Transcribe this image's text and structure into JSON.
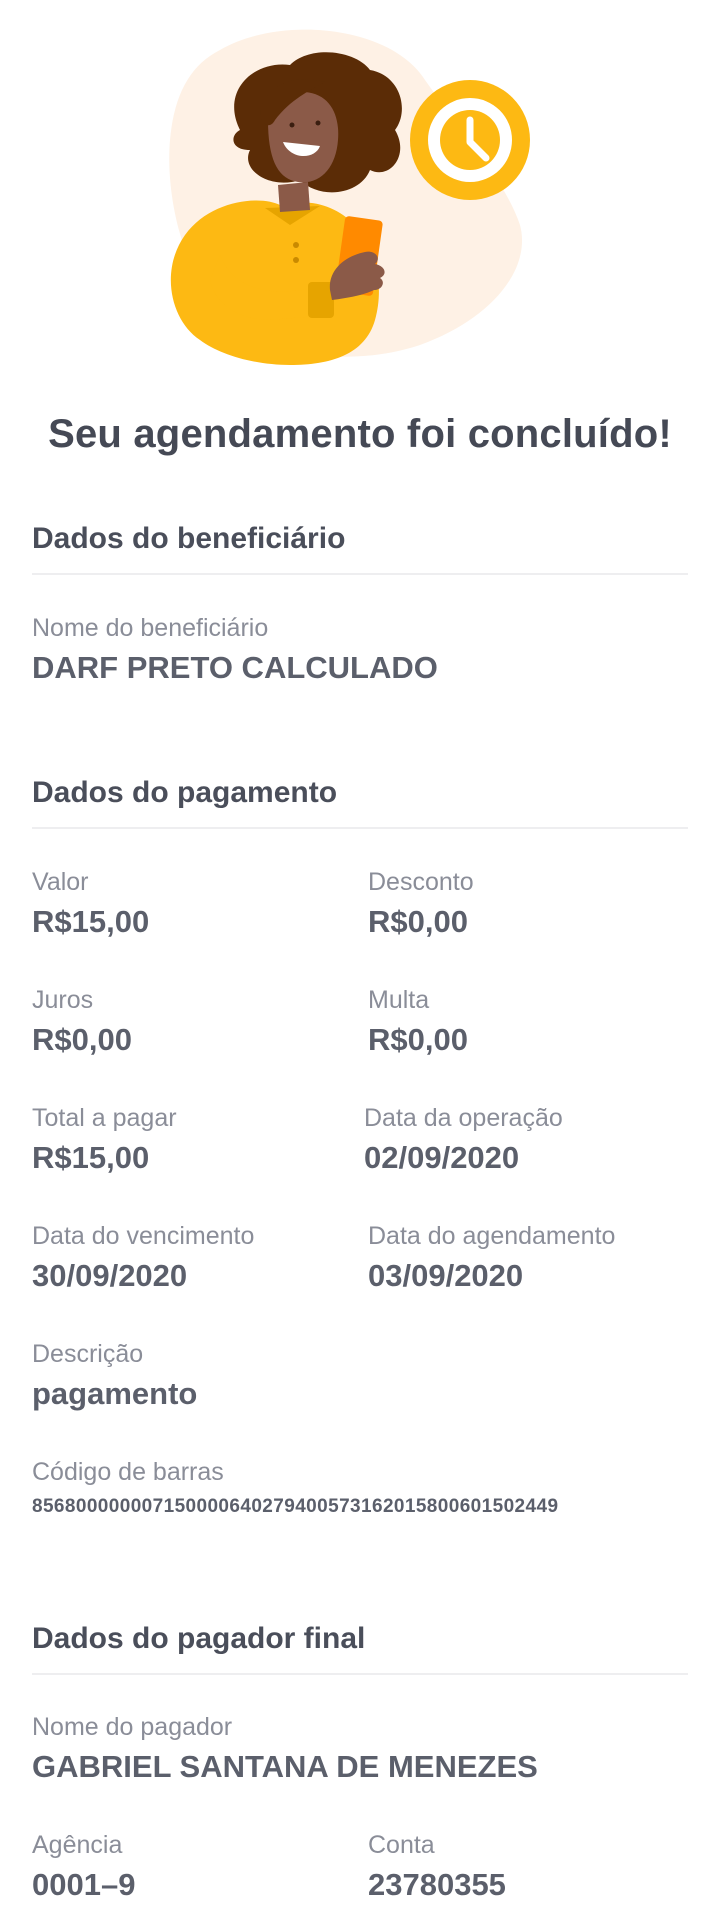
{
  "title": "Seu agendamento foi concluído!",
  "colors": {
    "accent_yellow": "#FDB913",
    "accent_orange": "#FF8A00",
    "background_blob": "#FEF1E5",
    "text_dark": "#4a4e5a",
    "text_label": "#8a8d98"
  },
  "illustration": {
    "icon": "clock-icon"
  },
  "beneficiary": {
    "section_title": "Dados do beneficiário",
    "name_label": "Nome do beneficiário",
    "name_value": "DARF PRETO CALCULADO"
  },
  "payment": {
    "section_title": "Dados do pagamento",
    "valor_label": "Valor",
    "valor_value": "R$15,00",
    "desconto_label": "Desconto",
    "desconto_value": "R$0,00",
    "juros_label": "Juros",
    "juros_value": "R$0,00",
    "multa_label": "Multa",
    "multa_value": "R$0,00",
    "total_label": "Total a pagar",
    "total_value": "R$15,00",
    "data_operacao_label": "Data da operação",
    "data_operacao_value": "02/09/2020",
    "data_vencimento_label": "Data do vencimento",
    "data_vencimento_value": "30/09/2020",
    "data_agendamento_label": "Data do agendamento",
    "data_agendamento_value": "03/09/2020",
    "descricao_label": "Descrição",
    "descricao_value": "pagamento",
    "codigo_barras_label": "Código de barras",
    "codigo_barras_value": "856800000007150000640279400573162015800601502449"
  },
  "payer": {
    "section_title": "Dados do pagador final",
    "name_label": "Nome do pagador",
    "name_value": "GABRIEL SANTANA DE MENEZES",
    "agencia_label": "Agência",
    "agencia_value": "0001–9",
    "conta_label": "Conta",
    "conta_value": "23780355"
  }
}
